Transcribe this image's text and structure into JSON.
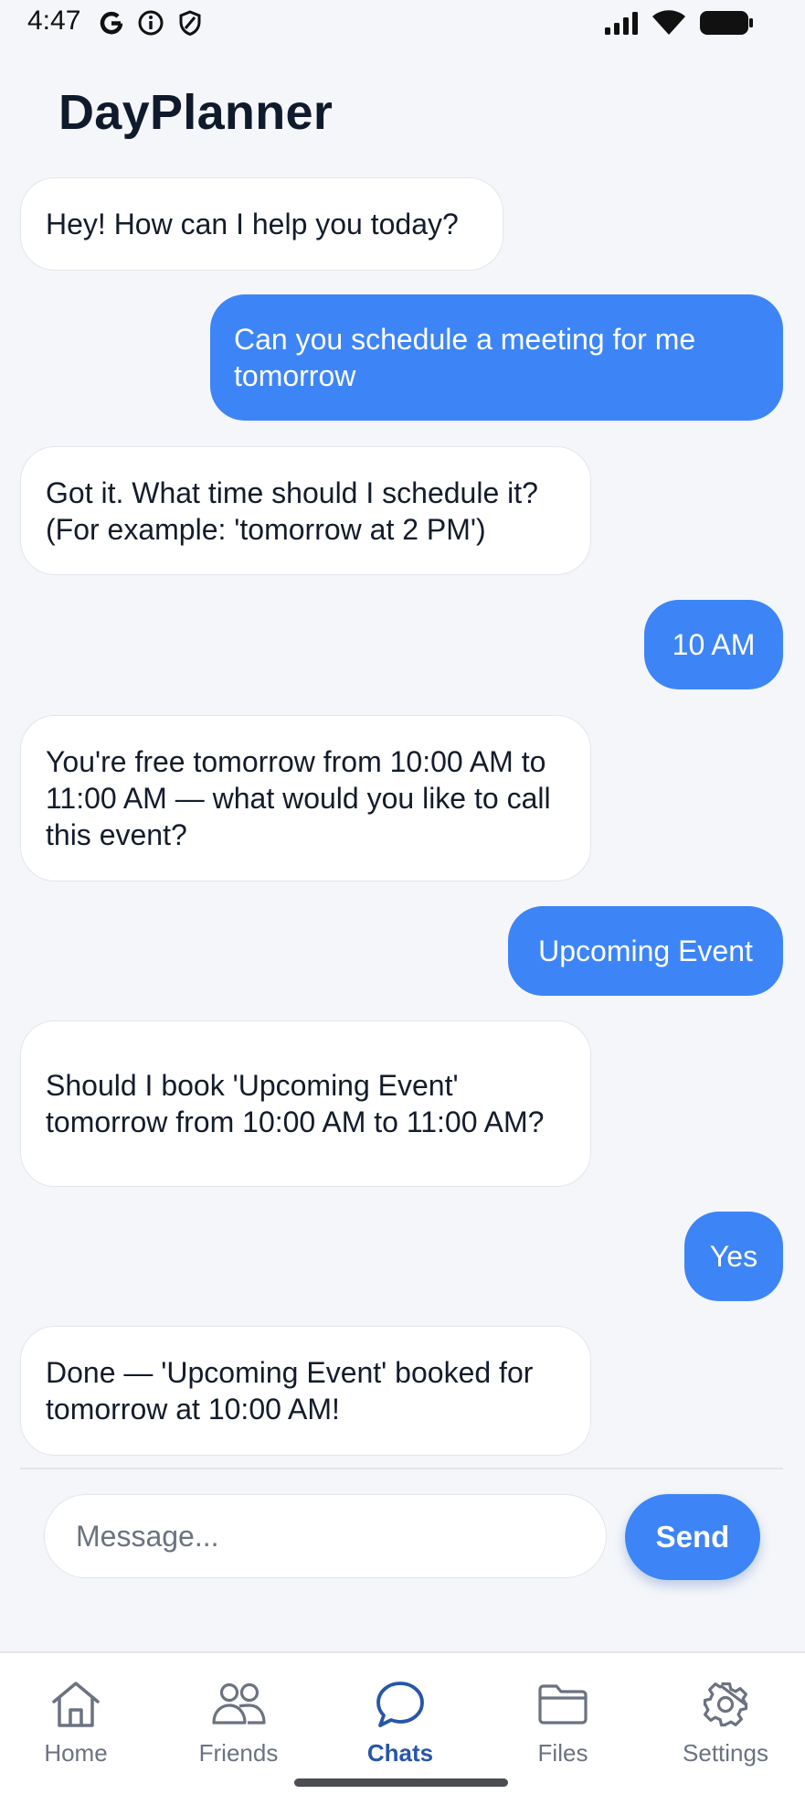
{
  "status_bar": {
    "time": "4:47",
    "left_icons": [
      "google-icon",
      "info-icon",
      "shield-icon"
    ],
    "right_icons": [
      "signal-icon",
      "wifi-icon",
      "battery-icon"
    ]
  },
  "header": {
    "title": "DayPlanner"
  },
  "messages": [
    {
      "sender": "bot",
      "text": "Hey! How can I help you today?"
    },
    {
      "sender": "user",
      "text": "Can you schedule a meeting for me tomorrow"
    },
    {
      "sender": "bot",
      "text": "Got it. What time should I schedule it? (For example: 'tomorrow at 2 PM')"
    },
    {
      "sender": "user",
      "text": "10 AM"
    },
    {
      "sender": "bot",
      "text": "You're free tomorrow from 10:00 AM to 11:00 AM — what would you like to call this event?"
    },
    {
      "sender": "user",
      "text": "Upcoming Event"
    },
    {
      "sender": "bot",
      "text": "Should I book 'Upcoming Event' tomorrow from 10:00 AM to 11:00 AM?"
    },
    {
      "sender": "user",
      "text": "Yes"
    },
    {
      "sender": "bot",
      "text": "Done — 'Upcoming Event' booked for tomorrow at 10:00 AM!"
    }
  ],
  "composer": {
    "placeholder": "Message...",
    "value": "",
    "send_label": "Send"
  },
  "nav": {
    "active": "chats",
    "items": [
      {
        "id": "home",
        "label": "Home",
        "icon": "home-icon"
      },
      {
        "id": "friends",
        "label": "Friends",
        "icon": "friends-icon"
      },
      {
        "id": "chats",
        "label": "Chats",
        "icon": "chat-bubble-icon"
      },
      {
        "id": "files",
        "label": "Files",
        "icon": "folder-icon"
      },
      {
        "id": "settings",
        "label": "Settings",
        "icon": "gear-icon"
      }
    ]
  },
  "colors": {
    "background": "#f4f6f9",
    "user_bubble": "#3d85f6",
    "bot_bubble": "#ffffff",
    "active_nav": "#2656a8",
    "inactive_nav": "#6b7280"
  }
}
